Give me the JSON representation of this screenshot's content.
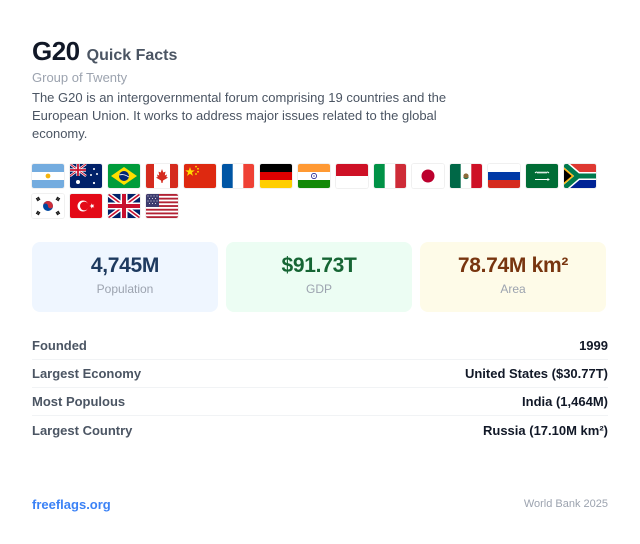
{
  "header": {
    "title": "G20",
    "title_suffix": "Quick Facts",
    "subtitle": "Group of Twenty",
    "description": "The G20 is an intergovernmental forum comprising 19 countries and the European Union. It works to address major issues related to the global economy."
  },
  "flags": [
    "argentina-flag",
    "australia-flag",
    "brazil-flag",
    "canada-flag",
    "china-flag",
    "france-flag",
    "germany-flag",
    "india-flag",
    "indonesia-flag",
    "italy-flag",
    "japan-flag",
    "mexico-flag",
    "russia-flag",
    "saudi-arabia-flag",
    "south-africa-flag",
    "south-korea-flag",
    "turkey-flag",
    "united-kingdom-flag",
    "united-states-flag"
  ],
  "stats": {
    "population": {
      "value": "4,745M",
      "label": "Population"
    },
    "gdp": {
      "value": "$91.73T",
      "label": "GDP"
    },
    "area": {
      "value": "78.74M km²",
      "label": "Area"
    }
  },
  "facts": [
    {
      "key": "Founded",
      "value": "1999"
    },
    {
      "key": "Largest Economy",
      "value": "United States ($30.77T)"
    },
    {
      "key": "Most Populous",
      "value": "India (1,464M)"
    },
    {
      "key": "Largest Country",
      "value": "Russia (17.10M km²)"
    }
  ],
  "footer": {
    "link": "freeflags.org",
    "source": "World Bank 2025"
  },
  "colors": {
    "accent": "#3b82f6",
    "population_bg": "#eff6ff",
    "gdp_bg": "#ecfdf3",
    "area_bg": "#fefbe8"
  }
}
